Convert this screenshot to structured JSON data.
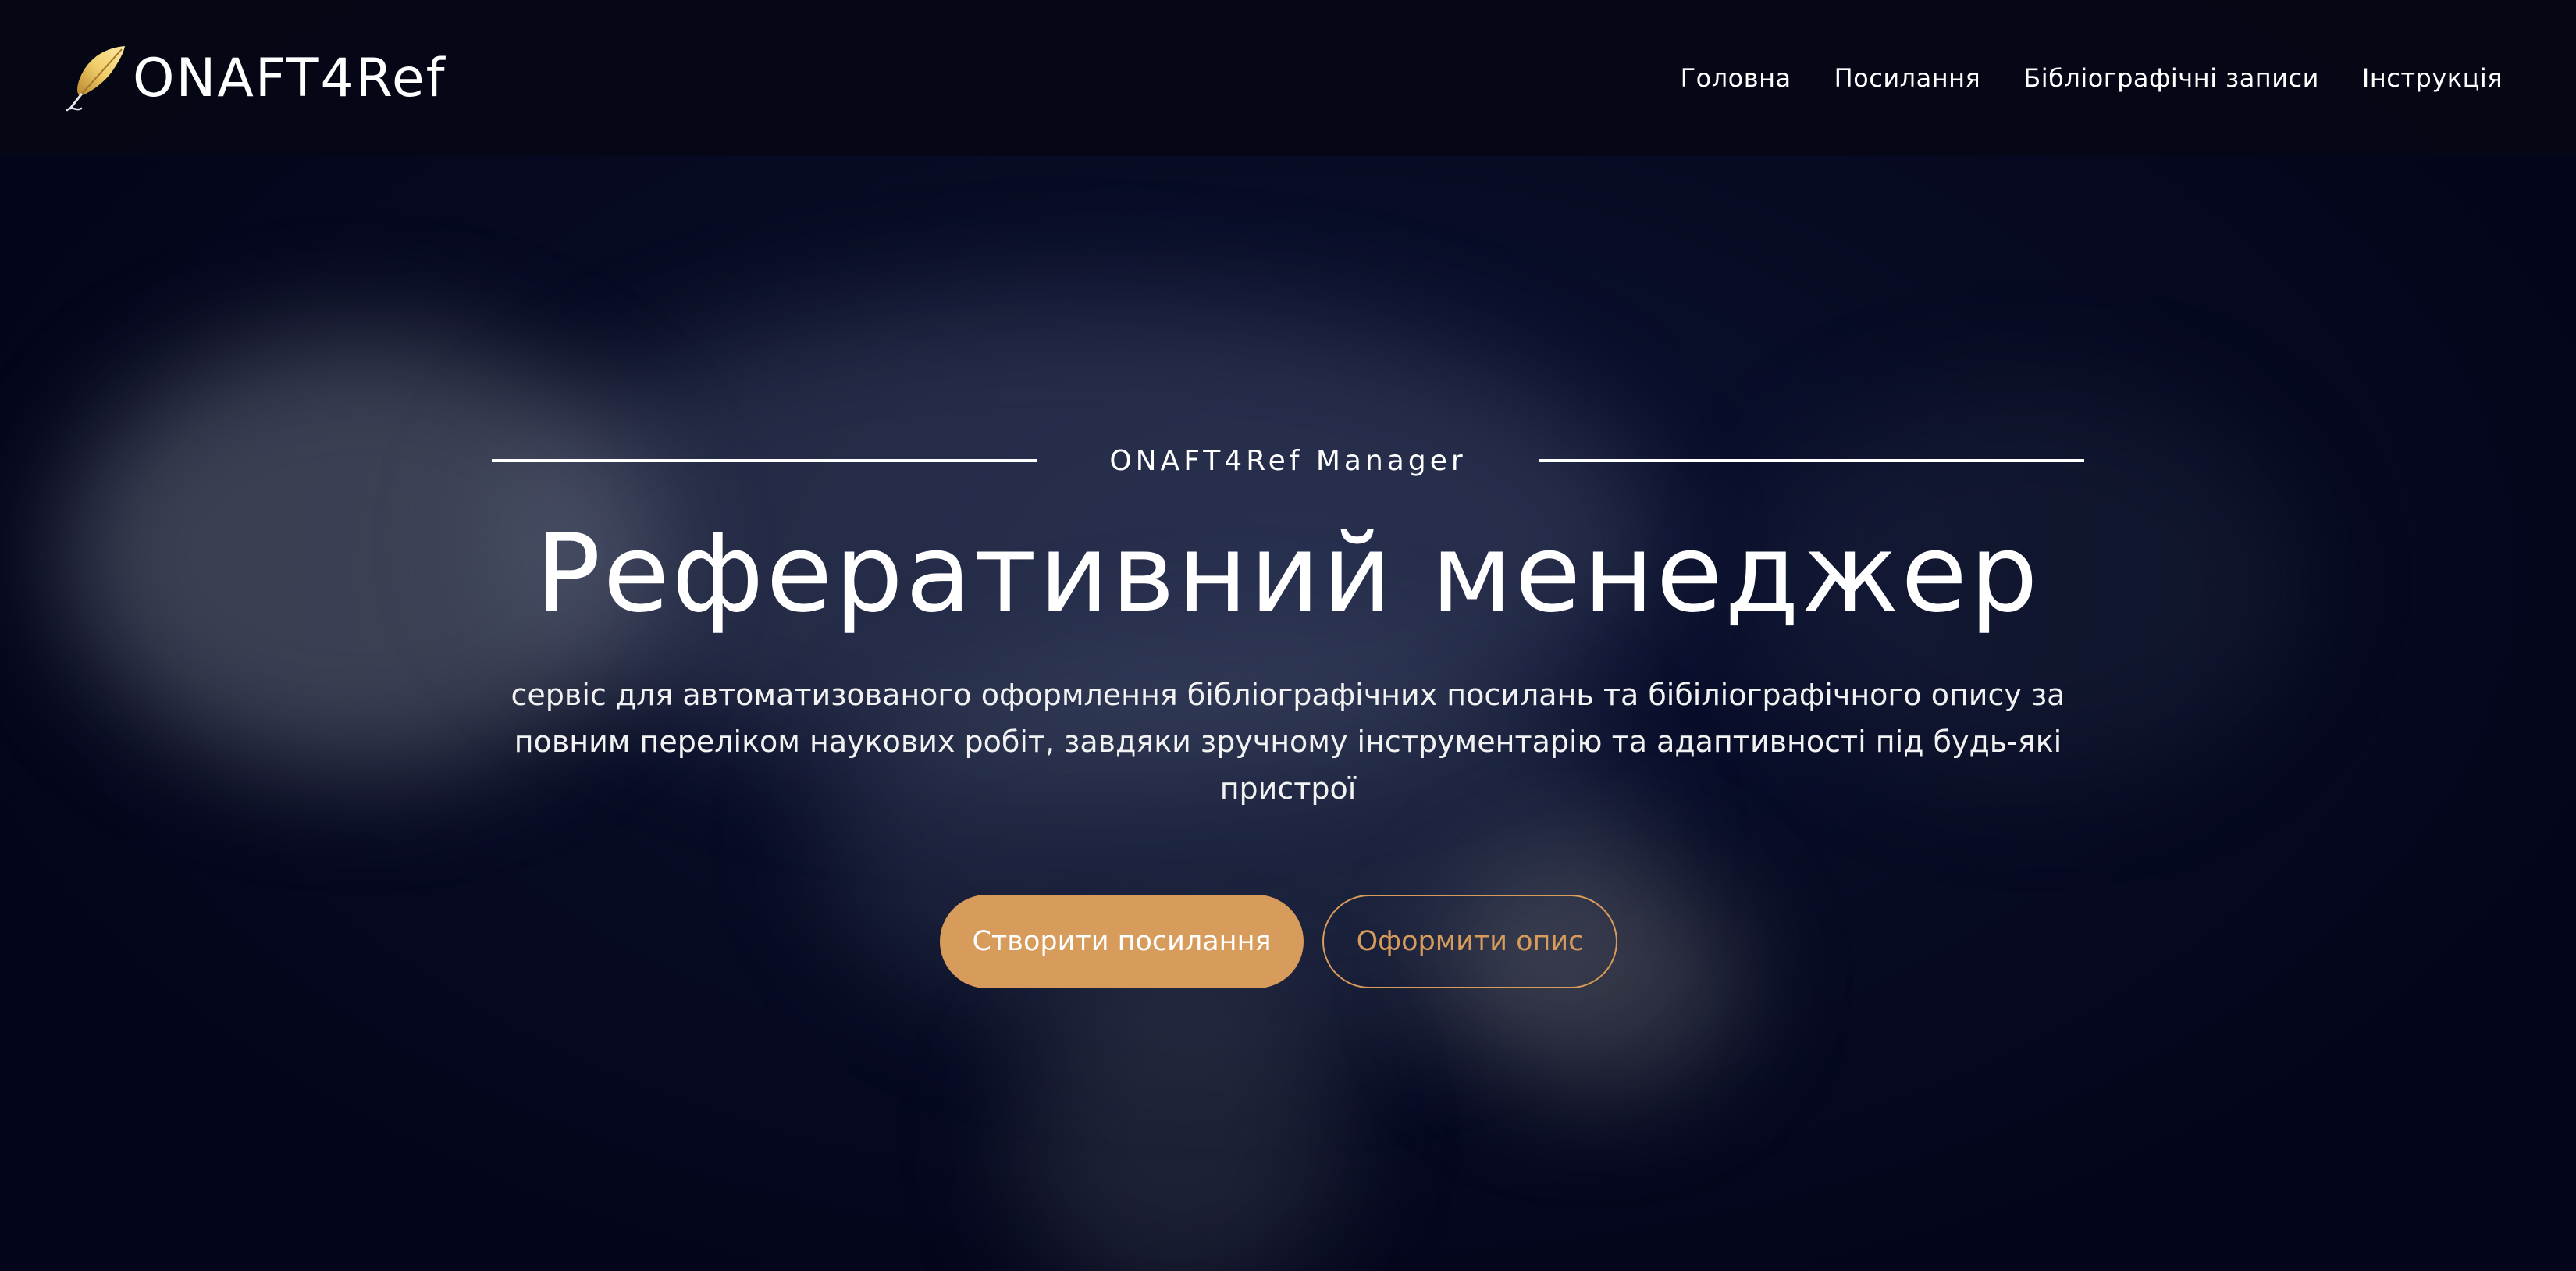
{
  "brand": {
    "name": "ONAFT4Ref",
    "logo_icon": "quill-feather-icon"
  },
  "nav": {
    "items": [
      {
        "label": "Головна"
      },
      {
        "label": "Посилання"
      },
      {
        "label": "Бібліографічні записи"
      },
      {
        "label": "Інструкція"
      }
    ]
  },
  "hero": {
    "eyebrow": "ONAFT4Ref Manager",
    "title": "Реферативний менеджер",
    "description": "сервіс для автоматизованого оформлення бібліографічних посилань та бібіліографічного опису за повним переліком наукових робіт, завдяки зручному інструментарію та адаптивності під будь-які пристрої",
    "primary_button": "Створити посилання",
    "secondary_button": "Оформити опис"
  },
  "colors": {
    "accent": "#d79b5b",
    "background": "#04071a",
    "navbar": "#050716",
    "text": "#ffffff"
  }
}
